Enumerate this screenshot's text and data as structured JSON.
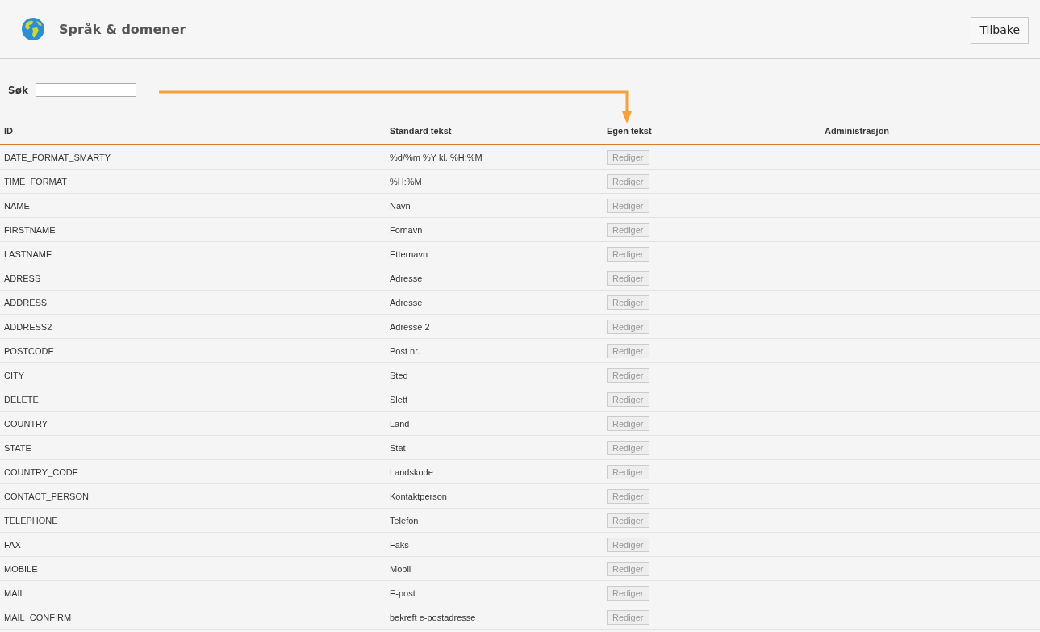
{
  "header": {
    "title": "Språk & domener",
    "back_button": "Tilbake"
  },
  "search": {
    "label": "Søk"
  },
  "table": {
    "columns": [
      "ID",
      "Standard tekst",
      "Egen tekst",
      "Administrasjon"
    ],
    "rows": [
      {
        "id": "DATE_FORMAT_SMARTY",
        "standard": "%d/%m %Y kl. %H:%M",
        "action": "Rediger",
        "disabled": true
      },
      {
        "id": "TIME_FORMAT",
        "standard": "%H:%M",
        "action": "Rediger",
        "disabled": true
      },
      {
        "id": "NAME",
        "standard": "Navn",
        "action": "Rediger",
        "disabled": true
      },
      {
        "id": "FIRSTNAME",
        "standard": "Fornavn",
        "action": "Rediger",
        "disabled": true
      },
      {
        "id": "LASTNAME",
        "standard": "Etternavn",
        "action": "Rediger",
        "disabled": true
      },
      {
        "id": "ADRESS",
        "standard": "Adresse",
        "action": "Rediger",
        "disabled": true
      },
      {
        "id": "ADDRESS",
        "standard": "Adresse",
        "action": "Rediger",
        "disabled": true
      },
      {
        "id": "ADDRESS2",
        "standard": "Adresse 2",
        "action": "Rediger",
        "disabled": true
      },
      {
        "id": "POSTCODE",
        "standard": "Post nr.",
        "action": "Rediger",
        "disabled": true
      },
      {
        "id": "CITY",
        "standard": "Sted",
        "action": "Rediger",
        "disabled": true
      },
      {
        "id": "DELETE",
        "standard": "Slett",
        "action": "Rediger",
        "disabled": true
      },
      {
        "id": "COUNTRY",
        "standard": "Land",
        "action": "Rediger",
        "disabled": true
      },
      {
        "id": "STATE",
        "standard": "Stat",
        "action": "Rediger",
        "disabled": true
      },
      {
        "id": "COUNTRY_CODE",
        "standard": "Landskode",
        "action": "Rediger",
        "disabled": true
      },
      {
        "id": "CONTACT_PERSON",
        "standard": "Kontaktperson",
        "action": "Rediger",
        "disabled": true
      },
      {
        "id": "TELEPHONE",
        "standard": "Telefon",
        "action": "Rediger",
        "disabled": true
      },
      {
        "id": "FAX",
        "standard": "Faks",
        "action": "Rediger",
        "disabled": true
      },
      {
        "id": "MOBILE",
        "standard": "Mobil",
        "action": "Rediger",
        "disabled": true
      },
      {
        "id": "MAIL",
        "standard": "E-post",
        "action": "Rediger",
        "disabled": true
      },
      {
        "id": "MAIL_CONFIRM",
        "standard": "bekreft e-postadresse",
        "action": "Rediger",
        "disabled": true
      }
    ]
  }
}
